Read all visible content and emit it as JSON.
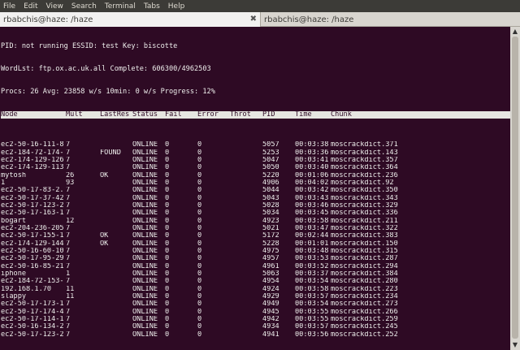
{
  "menu": [
    "File",
    "Edit",
    "View",
    "Search",
    "Terminal",
    "Tabs",
    "Help"
  ],
  "tabs": [
    {
      "title": "rbabchis@haze: /haze",
      "active": true
    },
    {
      "title": "rbabchis@haze: /haze",
      "active": false
    }
  ],
  "terminal": {
    "status_lines": [
      "PID: not running ESSID: test Key: biscotte",
      "WordLst: ftp.ox.ac.uk.all Complete: 606300/4962503",
      "Procs: 26 Avg: 23858 w/s 10min: 0 w/s Progress: 12%"
    ],
    "columns": [
      "Node",
      "Mult",
      "LastRes",
      "Status",
      "Fail",
      "Error",
      "Throt",
      "PID",
      "Time",
      "Chunk"
    ],
    "rows": [
      [
        "",
        "",
        "",
        "",
        "",
        "",
        "",
        "",
        "",
        ""
      ],
      [
        "ec2-50-16-111-8",
        "7",
        "",
        "ONLINE",
        "0",
        "0",
        "",
        "5057",
        "00:03:38",
        "moscrackdict.371"
      ],
      [
        "ec2-184-72-174-",
        "7",
        "FOUND",
        "ONLINE",
        "0",
        "0",
        "",
        "5253",
        "00:03:36",
        "moscrackdict.143"
      ],
      [
        "ec2-174-129-126",
        "7",
        "",
        "ONLINE",
        "0",
        "0",
        "",
        "5047",
        "00:03:41",
        "moscrackdict.357"
      ],
      [
        "ec2-174-129-113",
        "7",
        "",
        "ONLINE",
        "0",
        "0",
        "",
        "5050",
        "00:03:40",
        "moscrackdict.364"
      ],
      [
        "mytosh",
        "26",
        "OK",
        "ONLINE",
        "0",
        "0",
        "",
        "5220",
        "00:01:06",
        "moscrackdict.236"
      ],
      [
        "1",
        "93",
        "",
        "ONLINE",
        "0",
        "0",
        "",
        "4906",
        "00:04:02",
        "moscrackdict.92"
      ],
      [
        "ec2-50-17-83-2.",
        "7",
        "",
        "ONLINE",
        "0",
        "0",
        "",
        "5044",
        "00:03:42",
        "moscrackdict.350"
      ],
      [
        "ec2-50-17-37-42",
        "7",
        "",
        "ONLINE",
        "0",
        "0",
        "",
        "5043",
        "00:03:43",
        "moscrackdict.343"
      ],
      [
        "ec2-50-17-123-2",
        "7",
        "",
        "ONLINE",
        "0",
        "0",
        "",
        "5028",
        "00:03:46",
        "moscrackdict.329"
      ],
      [
        "ec2-50-17-163-1",
        "7",
        "",
        "ONLINE",
        "0",
        "0",
        "",
        "5034",
        "00:03:45",
        "moscrackdict.336"
      ],
      [
        "bogart",
        "12",
        "",
        "ONLINE",
        "0",
        "0",
        "",
        "4923",
        "00:03:58",
        "moscrackdict.211"
      ],
      [
        "ec2-204-236-205",
        "7",
        "",
        "ONLINE",
        "0",
        "0",
        "",
        "5021",
        "00:03:47",
        "moscrackdict.322"
      ],
      [
        "ec2-50-17-155-1",
        "7",
        "OK",
        "ONLINE",
        "0",
        "0",
        "",
        "5172",
        "00:02:44",
        "moscrackdict.383"
      ],
      [
        "ec2-174-129-144",
        "7",
        "OK",
        "ONLINE",
        "0",
        "0",
        "",
        "5228",
        "00:01:01",
        "moscrackdict.150"
      ],
      [
        "ec2-50-16-60-10",
        "7",
        "",
        "ONLINE",
        "0",
        "0",
        "",
        "4975",
        "00:03:48",
        "moscrackdict.315"
      ],
      [
        "ec2-50-17-95-29",
        "7",
        "",
        "ONLINE",
        "0",
        "0",
        "",
        "4957",
        "00:03:53",
        "moscrackdict.287"
      ],
      [
        "ec2-50-16-85-21",
        "7",
        "",
        "ONLINE",
        "0",
        "0",
        "",
        "4961",
        "00:03:52",
        "moscrackdict.294"
      ],
      [
        "iphone",
        "1",
        "",
        "ONLINE",
        "0",
        "0",
        "",
        "5063",
        "00:03:37",
        "moscrackdict.384"
      ],
      [
        "ec2-184-72-153-",
        "7",
        "",
        "ONLINE",
        "0",
        "0",
        "",
        "4954",
        "00:03:54",
        "moscrackdict.280"
      ],
      [
        "192.168.1.70",
        "11",
        "",
        "ONLINE",
        "0",
        "0",
        "",
        "4924",
        "00:03:58",
        "moscrackdict.223"
      ],
      [
        "slappy",
        "11",
        "",
        "ONLINE",
        "0",
        "0",
        "",
        "4929",
        "00:03:57",
        "moscrackdict.234"
      ],
      [
        "ec2-50-17-173-1",
        "7",
        "",
        "ONLINE",
        "0",
        "0",
        "",
        "4949",
        "00:03:54",
        "moscrackdict.273"
      ],
      [
        "ec2-50-17-174-4",
        "7",
        "",
        "ONLINE",
        "0",
        "0",
        "",
        "4945",
        "00:03:55",
        "moscrackdict.266"
      ],
      [
        "ec2-50-17-114-1",
        "7",
        "",
        "ONLINE",
        "0",
        "0",
        "",
        "4942",
        "00:03:55",
        "moscrackdict.259"
      ],
      [
        "ec2-50-16-134-2",
        "7",
        "",
        "ONLINE",
        "0",
        "0",
        "",
        "4934",
        "00:03:57",
        "moscrackdict.245"
      ],
      [
        "ec2-50-17-123-2",
        "7",
        "",
        "ONLINE",
        "0",
        "0",
        "",
        "4941",
        "00:03:56",
        "moscrackdict.252"
      ]
    ]
  },
  "colors": {
    "terminal_bg": "#2e0a24",
    "terminal_fg": "#eeeeec",
    "menubar_bg": "#3c3b37",
    "header_bg": "#e6e6e1"
  }
}
